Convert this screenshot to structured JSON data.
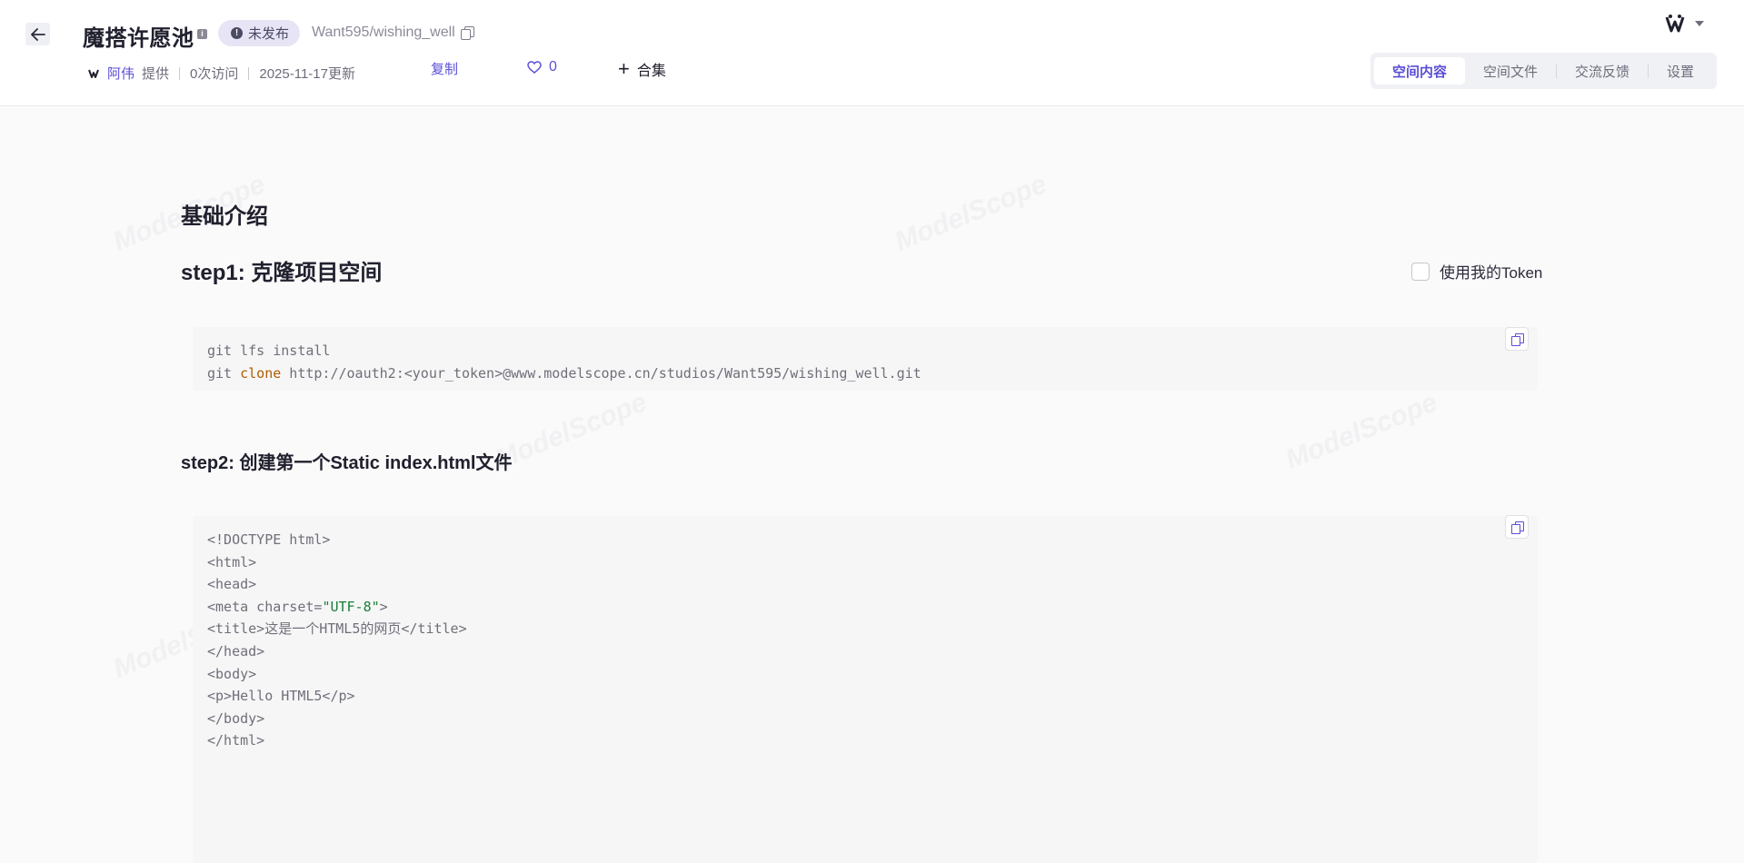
{
  "header": {
    "title": "魔搭许愿池",
    "status_badge": "未发布",
    "repo_path": "Want595/wishing_well",
    "author": "阿伟",
    "provided_label": "提供",
    "visits": "0次访问",
    "updated": "2025-11-17更新",
    "copy_label": "复制",
    "like_count": "0",
    "collection_label": "合集"
  },
  "tabs": [
    {
      "label": "空间内容",
      "active": true
    },
    {
      "label": "空间文件",
      "active": false
    },
    {
      "label": "交流反馈",
      "active": false
    },
    {
      "label": "设置",
      "active": false
    }
  ],
  "content": {
    "intro_heading": "基础介绍",
    "step1_heading": "step1: 克隆项目空间",
    "token_checkbox_label": "使用我的Token",
    "step1_code": {
      "line1": "git lfs install",
      "line2_cmd": "git ",
      "line2_kw": "clone",
      "line2_url": " http://oauth2:<your_token>@www.modelscope.cn/studios/Want595/wishing_well.git"
    },
    "step2_heading": "step2: 创建第一个Static index.html文件",
    "step2_code": {
      "l1": "<!DOCTYPE html>",
      "l2": "<html>",
      "l3": "<head>",
      "l4_pre": "<meta charset=",
      "l4_str": "\"UTF-8\"",
      "l4_post": ">",
      "l5": "<title>这是一个HTML5的网页</title>",
      "l6": "</head>",
      "l7": "<body>",
      "l8": "<p>Hello HTML5</p>",
      "l9": "</body>",
      "l10": "</html>"
    },
    "watermark": "ModelScope"
  },
  "colors": {
    "accent": "#5b4fd6",
    "keyword": "#b35c00",
    "string": "#188038"
  }
}
